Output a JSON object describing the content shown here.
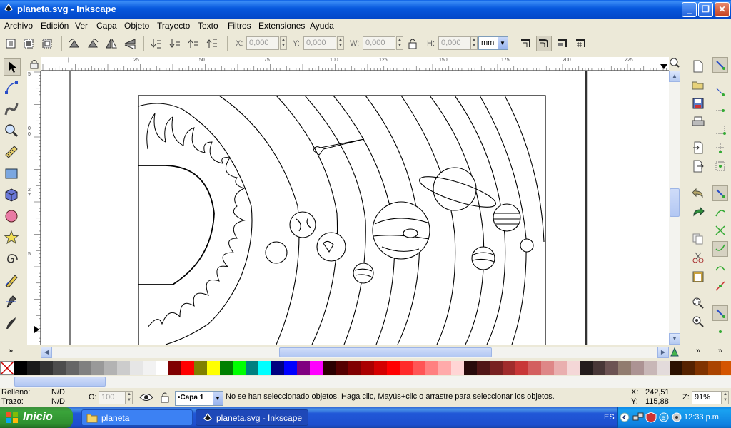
{
  "window": {
    "title": "planeta.svg - Inkscape",
    "buttons": {
      "minimize": "_",
      "maximize": "❐",
      "close": "✕"
    }
  },
  "menu": [
    "Archivo",
    "Edición",
    "Ver",
    "Capa",
    "Objeto",
    "Trayecto",
    "Texto",
    "Filtros",
    "Extensiones",
    "Ayuda"
  ],
  "controls": {
    "x_label": "X:",
    "x_value": "0,000",
    "y_label": "Y:",
    "y_value": "0,000",
    "w_label": "W:",
    "w_value": "0,000",
    "h_label": "H:",
    "h_value": "0,000",
    "unit": "mm"
  },
  "ruler": {
    "h_labels": [
      "|",
      "25",
      "50",
      "75",
      "100",
      "125",
      "150",
      "175",
      "200",
      "225"
    ],
    "v_labels": [
      "5",
      "0",
      "0",
      "2",
      "7",
      "5"
    ]
  },
  "tools": [
    "selector-tool",
    "node-tool",
    "tweak-tool",
    "zoom-tool",
    "measure-tool",
    "rect-tool",
    "3dbox-tool",
    "ellipse-tool",
    "star-tool",
    "spiral-tool",
    "pencil-tool",
    "pen-tool",
    "calligraphy-tool"
  ],
  "palette": [
    "#000000",
    "#1a1a1a",
    "#333333",
    "#4d4d4d",
    "#666666",
    "#808080",
    "#999999",
    "#b3b3b3",
    "#cccccc",
    "#e6e6e6",
    "#f2f2f2",
    "#ffffff",
    "#800000",
    "#ff0000",
    "#808000",
    "#ffff00",
    "#008000",
    "#00ff00",
    "#008080",
    "#00ffff",
    "#000080",
    "#0000ff",
    "#800080",
    "#ff00ff",
    "#2b0000",
    "#550000",
    "#800000",
    "#aa0000",
    "#d40000",
    "#ff0000",
    "#ff2a2a",
    "#ff5555",
    "#ff8080",
    "#ffaaaa",
    "#ffd5d5",
    "#280b0b",
    "#501616",
    "#782121",
    "#a02c2c",
    "#c83737",
    "#d35f5f",
    "#de8787",
    "#e9afaf",
    "#f4d7d7",
    "#241c1c",
    "#483737",
    "#6c5353",
    "#917c6f",
    "#ac9393",
    "#c8b7b7",
    "#e3dbdb",
    "#2b1100",
    "#552200",
    "#803300",
    "#aa4400",
    "#d45500",
    "#ff6600"
  ],
  "status": {
    "fill_label": "Relleno:",
    "fill_value": "N/D",
    "stroke_label": "Trazo:",
    "stroke_value": "N/D",
    "opacity_label": "O:",
    "opacity_value": "100",
    "layer": "•Capa 1",
    "message": "No se han seleccionado objetos. Haga clic, Mayús+clic o arrastre para seleccionar los objetos.",
    "x_label": "X:",
    "x_coord": "242,51",
    "y_label": "Y:",
    "y_coord": "115,88",
    "zoom_label": "Z:",
    "zoom": "91%"
  },
  "taskbar": {
    "start_label": "Inicio",
    "tasks": [
      {
        "label": "planeta"
      },
      {
        "label": "planeta.svg - Inkscape"
      }
    ],
    "lang": "ES",
    "clock": "12:33 p.m."
  }
}
